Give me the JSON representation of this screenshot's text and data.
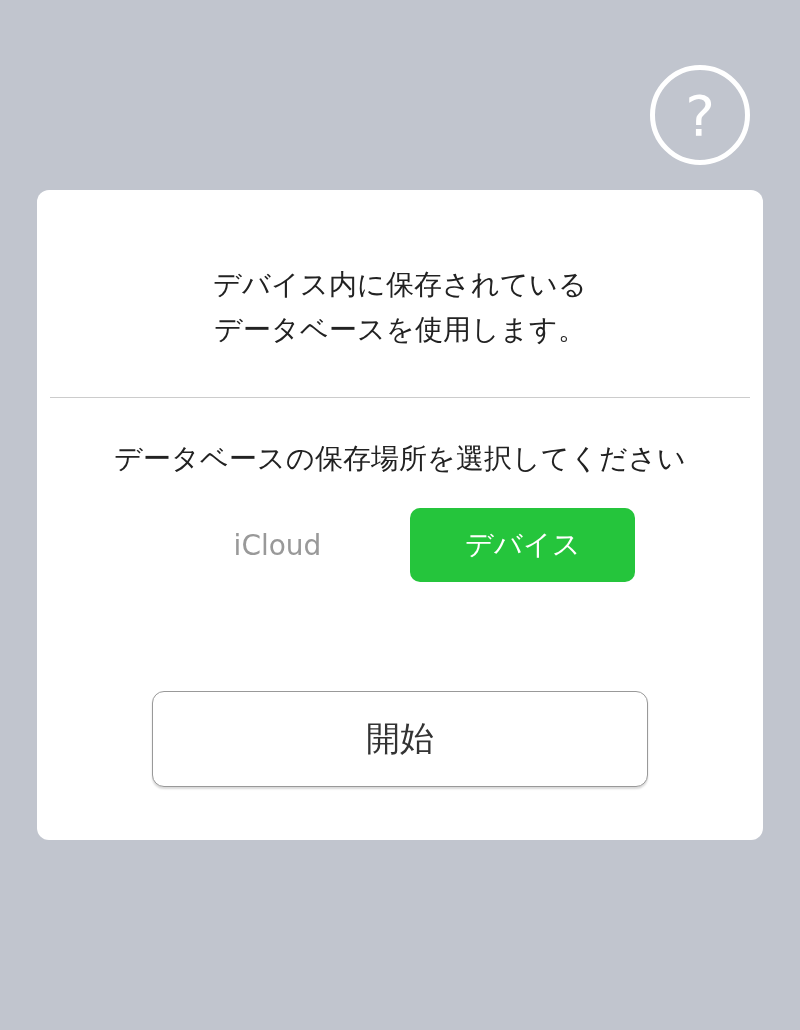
{
  "help_button": {
    "label": "?"
  },
  "message": [
    "デバイス内に保存されている",
    "データベースを使用します。"
  ],
  "prompt": "データベースの保存場所を選択してください",
  "storage_options": [
    {
      "label": "iCloud",
      "selected": false
    },
    {
      "label": "デバイス",
      "selected": true
    }
  ],
  "start_button": {
    "label": "開始"
  }
}
